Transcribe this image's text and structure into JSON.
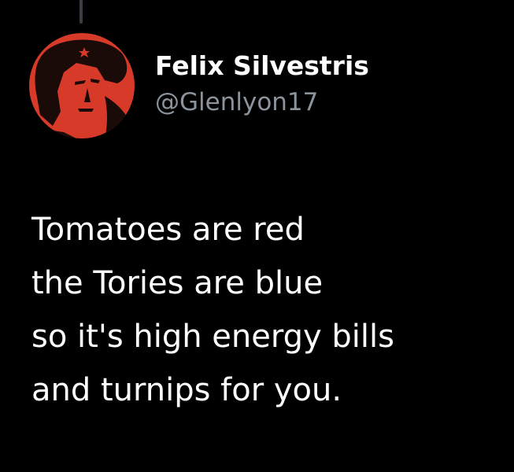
{
  "colors": {
    "background": "#000000",
    "thread_line": "#3a3e42",
    "text_primary": "#ffffff",
    "text_secondary": "#8b949c",
    "avatar_red": "#d83a2a",
    "avatar_dark": "#1a0a08"
  },
  "author": {
    "display_name": "Felix Silvestris",
    "handle": "@Glenlyon17",
    "avatar_icon": "profile-avatar"
  },
  "tweet": {
    "lines": [
      "Tomatoes are red",
      "the Tories are blue",
      "so it's high energy bills",
      "and turnips for you."
    ]
  }
}
